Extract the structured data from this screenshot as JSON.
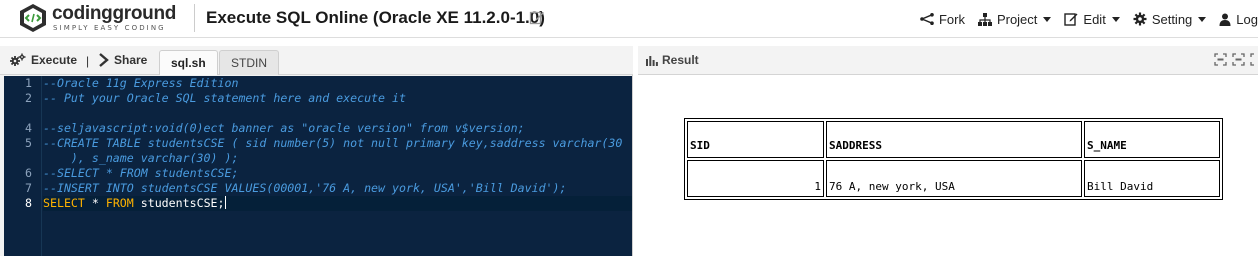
{
  "header": {
    "logo_text": "codingground",
    "logo_tagline": "SIMPLY EASY CODING",
    "title": "Execute SQL Online (Oracle XE 11.2.0-1.0)",
    "nav": [
      {
        "label": "Fork",
        "icon": "fork-icon"
      },
      {
        "label": "Project",
        "icon": "project-icon"
      },
      {
        "label": "Edit",
        "icon": "edit-icon"
      },
      {
        "label": "Setting",
        "icon": "gear-icon"
      },
      {
        "label": "Log",
        "icon": "user-icon"
      }
    ]
  },
  "editor_toolbar": {
    "execute_label": "Execute",
    "separator": "|",
    "share_label": "Share",
    "tabs": [
      {
        "label": "sql.sh",
        "active": true
      },
      {
        "label": "STDIN",
        "active": false
      }
    ]
  },
  "editor": {
    "line_numbers": [
      "1",
      "2",
      "",
      "4",
      "5",
      "",
      "6",
      "7",
      "8"
    ],
    "lines": [
      "--Oracle 11g Express Edition",
      "-- Put your Oracle SQL statement here and execute it",
      "",
      "--seljavascript:void(0)ect banner as \"oracle version\" from v$version;",
      "--CREATE TABLE studentsCSE ( sid number(5) not null primary key,saddress varchar(30",
      "    ), s_name varchar(30) );",
      "--SELECT * FROM studentsCSE;",
      "--INSERT INTO studentsCSE VALUES(00001,'76 A, new york, USA','Bill David');",
      "SELECT * FROM studentsCSE;"
    ],
    "last_line_parts": {
      "kw1": "SELECT",
      "mid": " * ",
      "kw2": "FROM",
      "rest": " studentsCSE;"
    },
    "colors": {
      "background": "#0b2340",
      "comment": "#4a9bdf",
      "keyword": "#ffb300",
      "text": "#ffffff"
    }
  },
  "result": {
    "title": "Result",
    "table": {
      "headers": [
        "SID",
        "SADDRESS",
        "S_NAME"
      ],
      "rows": [
        [
          "1",
          "76 A, new york, USA",
          "Bill David"
        ]
      ]
    }
  }
}
